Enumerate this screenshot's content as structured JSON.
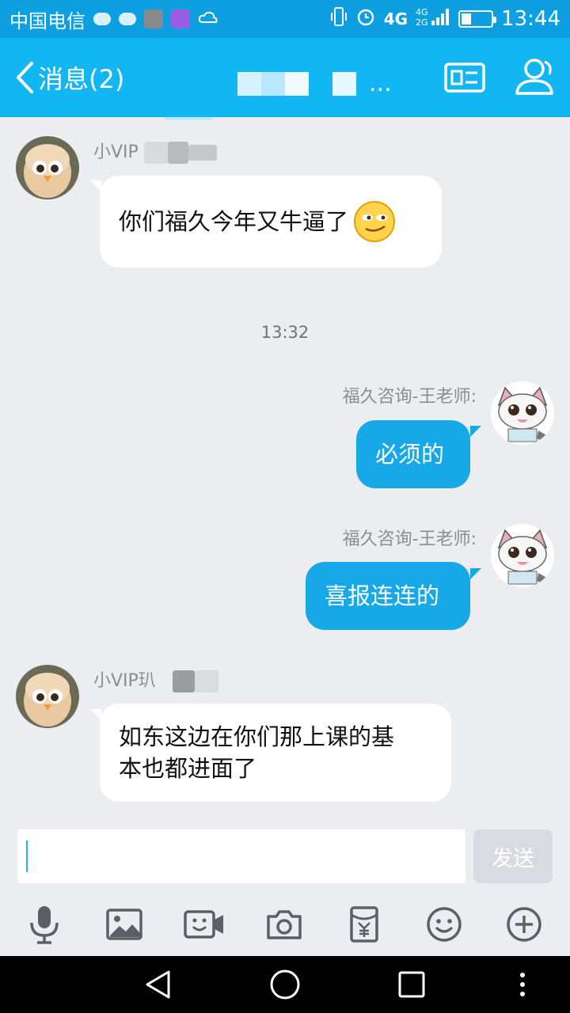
{
  "status_bar": {
    "carrier": "中国电信",
    "network": "4G",
    "time": "13:44"
  },
  "title_bar": {
    "back_label": "消息(2)",
    "conversation_title_suffix": "...",
    "accent_color": "#12b6f3"
  },
  "messages": [
    {
      "direction": "incoming",
      "sender": "小VIP",
      "text": "你们福久今年又牛逼了"
    },
    {
      "type": "timestamp",
      "text": "13:32"
    },
    {
      "direction": "outgoing",
      "sender": "福久咨询-王老师:",
      "text": "必须的"
    },
    {
      "direction": "outgoing",
      "sender": "福久咨询-王老师:",
      "text": "喜报连连的"
    },
    {
      "direction": "incoming",
      "sender": "小VIP玐",
      "text_line1": "如东这边在你们那上课的基",
      "text_line2": "本也都进面了"
    }
  ],
  "input": {
    "value": "",
    "send_label": "发送"
  },
  "toolbar": {
    "icons": [
      "microphone-icon",
      "image-icon",
      "video-call-icon",
      "camera-icon",
      "red-packet-icon",
      "emoji-icon",
      "plus-icon"
    ]
  },
  "nav_bar": {
    "icons": [
      "back-triangle-icon",
      "home-circle-icon",
      "recents-square-icon",
      "more-icon"
    ]
  }
}
